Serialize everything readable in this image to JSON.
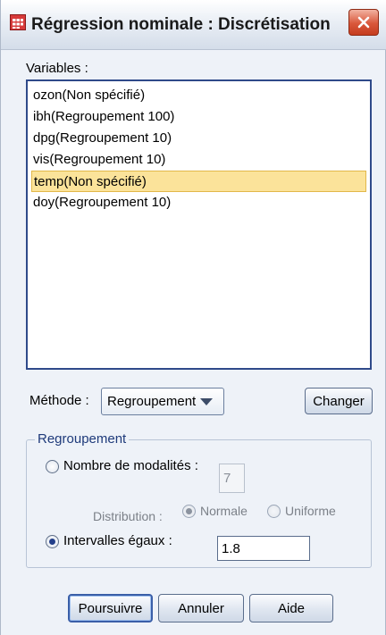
{
  "window": {
    "title": "Régression nominale : Discrétisation",
    "icon": "spreadsheet-icon",
    "close_icon": "close-icon"
  },
  "variables": {
    "label": "Variables :",
    "items": [
      "ozon(Non spécifié)",
      "ibh(Regroupement 100)",
      "dpg(Regroupement 10)",
      "vis(Regroupement 10)",
      "temp(Non spécifié)",
      "doy(Regroupement 10)"
    ],
    "selected_index": 4
  },
  "method": {
    "label": "Méthode :",
    "selected": "Regroupement",
    "change_button": "Changer"
  },
  "grouping": {
    "legend": "Regroupement",
    "categories_label": "Nombre de modalités :",
    "categories_value": "7",
    "distribution_label": "Distribution :",
    "normal_label": "Normale",
    "uniform_label": "Uniforme",
    "intervals_label": "Intervalles égaux :",
    "intervals_value": "1.8"
  },
  "buttons": {
    "continue": "Poursuivre",
    "cancel": "Annuler",
    "help": "Aide"
  },
  "colors": {
    "selection": "#fbe39a",
    "list_border": "#2f4a8a",
    "close_button": "#d9573a"
  }
}
